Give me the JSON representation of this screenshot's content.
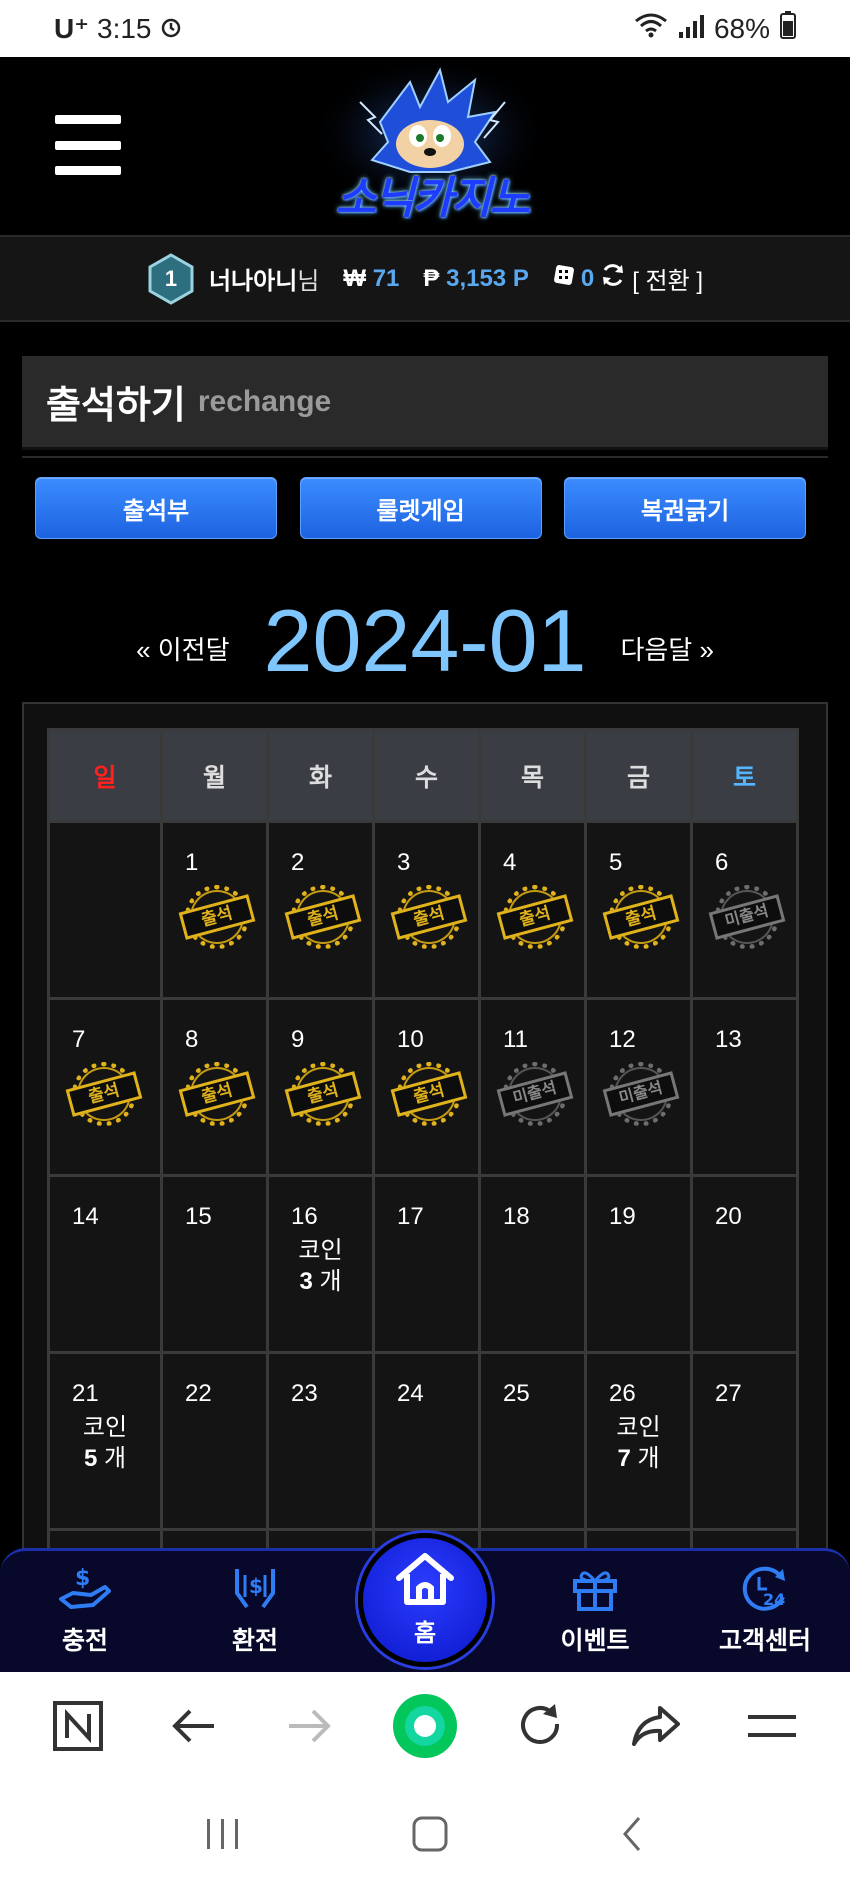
{
  "status": {
    "carrier": "U⁺",
    "time": "3:15",
    "battery": "68%"
  },
  "header": {
    "logo_text": "소닉카지노"
  },
  "user": {
    "level": "1",
    "name": "너나아니",
    "name_suffix": "님",
    "won_symbol": "₩",
    "won_value": "71",
    "point_symbol": "₱",
    "point_value": "3,153 P",
    "coin_value": "0",
    "swap_label": "[ 전환 ]"
  },
  "section": {
    "title": "출석하기",
    "subtitle": "rechange"
  },
  "tabs": [
    {
      "label": "출석부"
    },
    {
      "label": "룰렛게임"
    },
    {
      "label": "복권긁기"
    }
  ],
  "month_nav": {
    "prev": "« 이전달",
    "title": "2024-01",
    "next": "다음달 »"
  },
  "calendar": {
    "weekdays": [
      "일",
      "월",
      "화",
      "수",
      "목",
      "금",
      "토"
    ],
    "stamp_attend": "출석",
    "stamp_miss": "미출석",
    "coin_word": "코인",
    "coin_unit": "개",
    "weeks": [
      [
        {
          "day": ""
        },
        {
          "day": "1",
          "stamp": "attend"
        },
        {
          "day": "2",
          "stamp": "attend"
        },
        {
          "day": "3",
          "stamp": "attend"
        },
        {
          "day": "4",
          "stamp": "attend"
        },
        {
          "day": "5",
          "stamp": "attend"
        },
        {
          "day": "6",
          "stamp": "miss"
        }
      ],
      [
        {
          "day": "7",
          "stamp": "attend"
        },
        {
          "day": "8",
          "stamp": "attend"
        },
        {
          "day": "9",
          "stamp": "attend"
        },
        {
          "day": "10",
          "stamp": "attend"
        },
        {
          "day": "11",
          "stamp": "miss"
        },
        {
          "day": "12",
          "stamp": "miss"
        },
        {
          "day": "13"
        }
      ],
      [
        {
          "day": "14"
        },
        {
          "day": "15"
        },
        {
          "day": "16",
          "coins": "3"
        },
        {
          "day": "17"
        },
        {
          "day": "18"
        },
        {
          "day": "19"
        },
        {
          "day": "20"
        }
      ],
      [
        {
          "day": "21",
          "coins": "5"
        },
        {
          "day": "22"
        },
        {
          "day": "23"
        },
        {
          "day": "24"
        },
        {
          "day": "25"
        },
        {
          "day": "26",
          "coins": "7"
        },
        {
          "day": "27"
        }
      ]
    ]
  },
  "bottom_nav": {
    "charge": "충전",
    "exchange": "환전",
    "home": "홈",
    "event": "이벤트",
    "support": "고객센터"
  },
  "colors": {
    "accent_blue": "#2f7df5",
    "nav_bg": "#07082a",
    "stamp_gold": "#e0b21c",
    "month_title": "#7fc6ff"
  }
}
